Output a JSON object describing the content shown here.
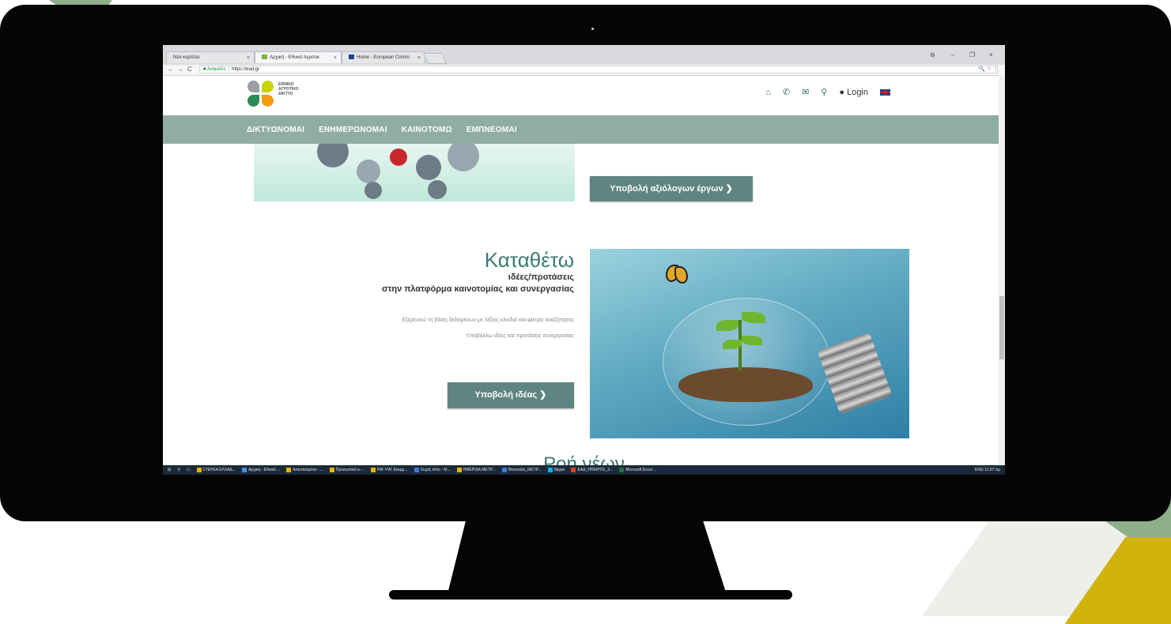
{
  "browser": {
    "tabs": [
      {
        "label": "Νέα καρτέλα"
      },
      {
        "label": "Αρχική - Εθνικό Αγροτικ"
      },
      {
        "label": "Home - European Comm"
      }
    ],
    "window_controls": {
      "account": "⊖",
      "minimize": "–",
      "maximize": "❐",
      "close": "×"
    },
    "address": {
      "secure_label": "Ασφαλές",
      "url": "https://ead.gr"
    }
  },
  "site": {
    "logo": {
      "line1": "ΕΘΝΙΚΟ",
      "line2": "ΑΓΡΟΤΙΚΟ",
      "line3": "ΔΙΚΤΥΟ"
    },
    "header": {
      "login_label": "Login"
    },
    "nav": [
      {
        "label": "ΔΙΚΤΥΩΝΟΜΑΙ"
      },
      {
        "label": "ΕΝΗΜΕΡΩΝΟΜΑΙ"
      },
      {
        "label": "ΚΑΙΝΟΤΟΜΩ"
      },
      {
        "label": "ΕΜΠΝΕΟΜΑΙ"
      }
    ],
    "works": {
      "button_label": "Υποβολή αξιόλογων έργων ❯"
    },
    "ideas": {
      "title": "Καταθέτω",
      "subtitle1": "ιδέες/προτάσεις",
      "subtitle2": "στην πλατφόρμα καινοτομίας και συνεργασίας",
      "desc1": "Εξερευνώ τη βάση δεδομένων με λέξεις κλειδιά και φίλτρα αναζήτησης",
      "desc2": "Υποβάλλω ιδέες και προτάσεις συνεργασίας",
      "button_label": "Υποβολή ιδέας ❯"
    },
    "news": {
      "title": "Ροή νέων"
    }
  },
  "taskbar": {
    "items": [
      {
        "label": "ΣΤΕΡΕΑ ΕΛΛΑΔ...",
        "color": "#e8b400"
      },
      {
        "label": "Αρχική - Εθνικό ...",
        "color": "#4a8af4"
      },
      {
        "label": "Απεσταλμένα - ...",
        "color": "#e8b400"
      },
      {
        "label": "Προσωπικό e-...",
        "color": "#e8b400"
      },
      {
        "label": "FW: FW: Εκερμ...",
        "color": "#e8b400"
      },
      {
        "label": "Χωρίς τίτλο - M...",
        "color": "#3a7bd5"
      },
      {
        "label": "ΗΜΕΡΙΔΑ ΜΕΤΡ...",
        "color": "#e8b400"
      },
      {
        "label": "Θεσσαλία_ΜΕΤΡ...",
        "color": "#3a7bd5"
      },
      {
        "label": "Skype",
        "color": "#00aff0"
      },
      {
        "label": "ΕΑΔ_ΗΠΕΙΡΟΣ_3...",
        "color": "#d24726"
      },
      {
        "label": "Microsoft Excel ...",
        "color": "#1e7145"
      }
    ],
    "tray": "ENG 11:57 πμ"
  },
  "colors": {
    "accent": "#8fada5",
    "button": "#5f8582",
    "heading": "#3e7a72"
  }
}
